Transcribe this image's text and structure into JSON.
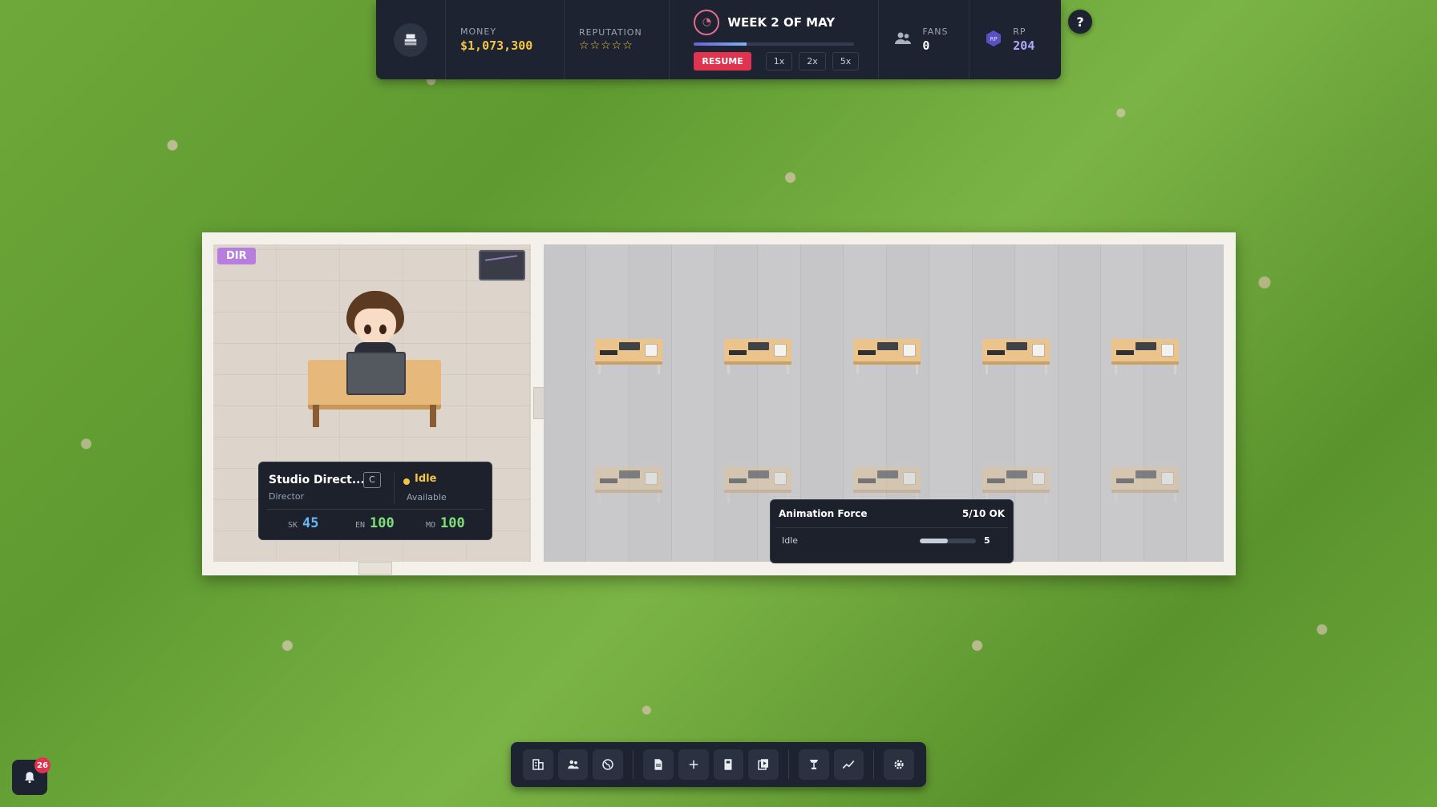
{
  "hud": {
    "money_label": "MONEY",
    "money_value": "$1,073,300",
    "reputation_label": "REPUTATION",
    "reputation_stars": "☆☆☆☆☆",
    "reputation_rating": 0,
    "week_title": "WEEK 2 OF MAY",
    "week_progress": 0.33,
    "resume_label": "RESUME",
    "speeds": [
      "1x",
      "2x",
      "5x"
    ],
    "fans_label": "FANS",
    "fans_value": "0",
    "rp_label": "RP",
    "rp_value": "204",
    "help_label": "?"
  },
  "director_room": {
    "badge": "DIR",
    "card": {
      "name": "Studio Direct...",
      "tag": "C",
      "role": "Director",
      "status": "Idle",
      "availability": "Available",
      "stats": [
        {
          "key": "SK",
          "value": "45"
        },
        {
          "key": "EN",
          "value": "100"
        },
        {
          "key": "MO",
          "value": "100"
        }
      ]
    }
  },
  "team": {
    "name": "Animation Force",
    "count": "5/10 OK",
    "status": "Idle",
    "value": "5",
    "bar_fill": 0.5
  },
  "toolbar": {
    "icons": [
      "office-icon",
      "staff-icon",
      "globe-icon",
      "document-icon",
      "plus-icon",
      "book-icon",
      "library-icon",
      "award-icon",
      "chart-icon",
      "settings-icon"
    ]
  },
  "notifications": {
    "count": "26"
  },
  "colors": {
    "hud_bg": "#1d2330",
    "money": "#f4c542",
    "resume": "#e0334f",
    "rp": "#b4a7ff",
    "dir_badge": "#b77ee0",
    "skill": "#69b7f4",
    "energy": "#7fe07a"
  }
}
